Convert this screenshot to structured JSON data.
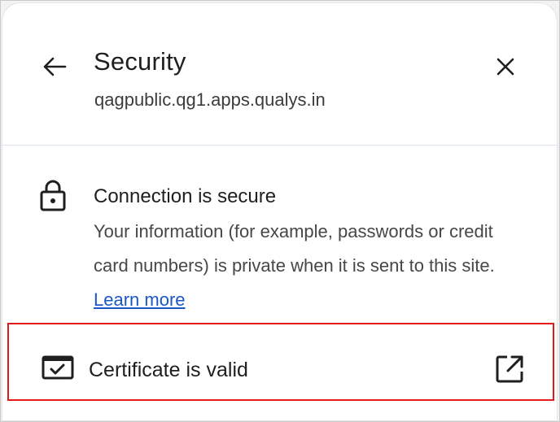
{
  "header": {
    "title": "Security",
    "site": "qagpublic.qg1.apps.qualys.in",
    "back_icon": "arrow-back-icon",
    "close_icon": "close-icon"
  },
  "connection": {
    "icon": "lock-icon",
    "title": "Connection is secure",
    "description": "Your information (for example, passwords or credit card numbers) is private when it is sent to this site.",
    "learn_more": "Learn more"
  },
  "certificate": {
    "icon": "certificate-icon",
    "label": "Certificate is valid",
    "action_icon": "open-in-new-icon",
    "highlight_color": "#e41a1a"
  }
}
